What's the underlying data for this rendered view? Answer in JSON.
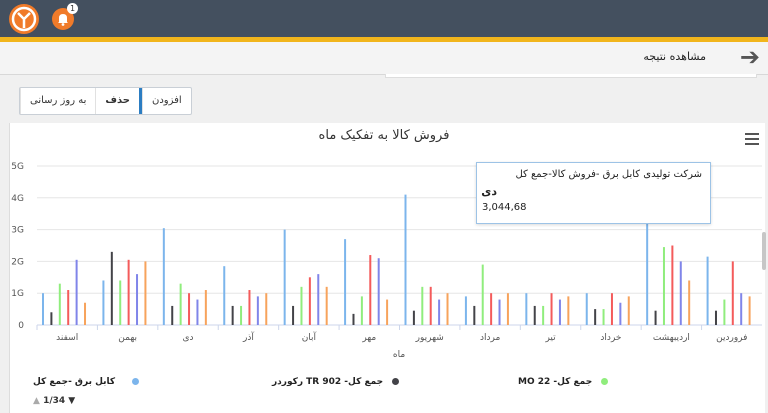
{
  "topbar": {
    "notification_count": "1"
  },
  "header": {
    "title": "مشاهده نتیجه"
  },
  "toolbar": {
    "add_label": "افزودن",
    "delete_label": "حذف",
    "update_label": "به روز رسانی"
  },
  "colors": {
    "accent": "#f1b51c",
    "topbar": "#44505f",
    "brand_orange": "#f07b2a"
  },
  "icons": {
    "back": "arrow-right-icon",
    "menu": "hamburger-menu-icon",
    "logo": "logo-icon",
    "bell": "bell-icon"
  },
  "chart_data": {
    "type": "bar",
    "title": "فروش کالا به تفکیک ماه",
    "xlabel": "ماه",
    "ylabel": "",
    "ylim": [
      0,
      5
    ],
    "y_ticks": [
      "0",
      "1G",
      "2G",
      "3G",
      "4G",
      "5G"
    ],
    "categories": [
      "فروردین",
      "اردیبهشت",
      "خرداد",
      "تیر",
      "مرداد",
      "شهریور",
      "مهر",
      "آبان",
      "آذر",
      "دی",
      "بهمن",
      "اسفند"
    ],
    "series": [
      {
        "name": "کابل برق -جمع کل",
        "color": "#7cb5ec",
        "values": [
          2.15,
          3.8,
          1.0,
          1.0,
          0.9,
          4.1,
          2.7,
          3.0,
          1.85,
          3.04468,
          1.4,
          1.0
        ]
      },
      {
        "name": "جمع کل- TR 902 رکوردر",
        "color": "#434348",
        "values": [
          0.45,
          0.45,
          0.5,
          0.6,
          0.6,
          0.45,
          0.35,
          0.6,
          0.6,
          0.6,
          2.3,
          0.4
        ]
      },
      {
        "name": "جمع کل- MO 22",
        "color": "#90ed7d",
        "values": [
          0.8,
          2.45,
          0.5,
          0.6,
          1.9,
          1.2,
          0.9,
          1.2,
          0.6,
          1.3,
          1.4,
          1.3
        ]
      },
      {
        "name": "",
        "color": "#f45b5b",
        "values": [
          2.0,
          2.5,
          1.0,
          1.0,
          1.0,
          1.2,
          2.2,
          1.5,
          1.1,
          1.0,
          2.05,
          1.1
        ]
      },
      {
        "name": "",
        "color": "#8085e9",
        "values": [
          1.0,
          2.0,
          0.7,
          0.8,
          0.8,
          0.8,
          2.1,
          1.6,
          0.9,
          0.8,
          1.6,
          2.05
        ]
      },
      {
        "name": "",
        "color": "#f7a35c",
        "values": [
          0.9,
          1.4,
          0.9,
          0.9,
          1.0,
          1.0,
          0.8,
          1.2,
          1.0,
          1.1,
          2.0,
          0.7
        ]
      }
    ]
  },
  "tooltip": {
    "series": "شرکت تولیدی کابل برق -فروش کالا-جمع کل",
    "category": "دی",
    "value": "3,044,68"
  },
  "legend": {
    "items": [
      {
        "name": "کابل برق -جمع کل",
        "color": "#7cb5ec"
      },
      {
        "name": "جمع کل- TR 902 رکوردر",
        "color": "#434348"
      },
      {
        "name": "جمع کل- MO 22",
        "color": "#90ed7d"
      }
    ],
    "page": "1/34"
  }
}
